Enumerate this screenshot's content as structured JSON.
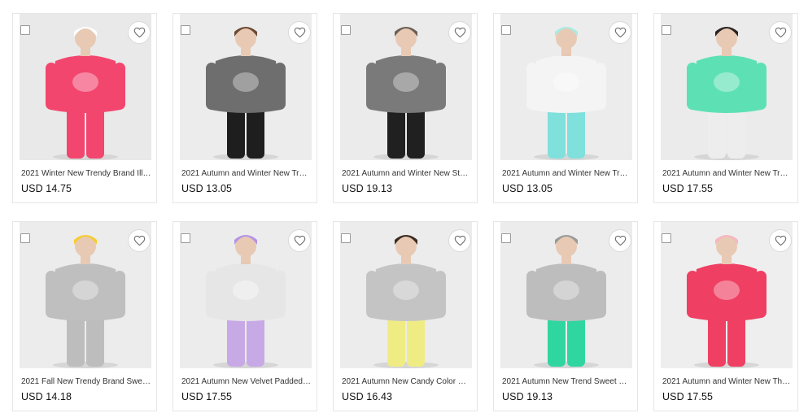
{
  "products": [
    {
      "title": "2021 Winter New Trendy Brand Illu…",
      "price": "USD 14.75",
      "palette": {
        "bg": "#e9e9e9",
        "top": "#f2466f",
        "bottom": "#f2466f",
        "hat": "#ffffff",
        "skin": "#e8c9b3"
      }
    },
    {
      "title": "2021 Autumn and Winter New Tren…",
      "price": "USD 13.05",
      "palette": {
        "bg": "#ececec",
        "top": "#6e6e6e",
        "bottom": "#1e1e1e",
        "hat": "#6b4a34",
        "skin": "#e8c9b3"
      }
    },
    {
      "title": "2021 Autumn and Winter New Styl…",
      "price": "USD 19.13",
      "palette": {
        "bg": "#ebebeb",
        "top": "#7a7a7a",
        "bottom": "#202020",
        "hat": "#6a6057",
        "skin": "#e8c9b3"
      }
    },
    {
      "title": "2021 Autumn and Winter New Tren…",
      "price": "USD 13.05",
      "palette": {
        "bg": "#ececec",
        "top": "#f4f4f4",
        "bottom": "#7fe0dc",
        "hat": "#a9ece3",
        "skin": "#e8c9b3"
      }
    },
    {
      "title": "2021 Autumn and Winter New Tren…",
      "price": "USD 17.55",
      "palette": {
        "bg": "#ebebeb",
        "top": "#5ee0b5",
        "bottom": "#ededed",
        "hat": "#2a2320",
        "skin": "#e8c9b3"
      }
    },
    {
      "title": "2021 Fall New Trendy Brand Sweet …",
      "price": "USD 14.18",
      "palette": {
        "bg": "#ececec",
        "top": "#bfbfbf",
        "bottom": "#bdbdbd",
        "hat": "#f6cc2f",
        "skin": "#e8c9b3"
      }
    },
    {
      "title": "2021 Autumn New Velvet Padded L…",
      "price": "USD 17.55",
      "palette": {
        "bg": "#ececec",
        "top": "#e6e6e6",
        "bottom": "#c7a9e6",
        "hat": "#b393e6",
        "skin": "#e8c9b3"
      }
    },
    {
      "title": "2021 Autumn New Candy Color Gir…",
      "price": "USD 16.43",
      "palette": {
        "bg": "#ececec",
        "top": "#c4c4c4",
        "bottom": "#f0ec84",
        "hat": "#3a2a20",
        "skin": "#e8c9b3"
      }
    },
    {
      "title": "2021 Autumn New Trend Sweet Co…",
      "price": "USD 19.13",
      "palette": {
        "bg": "#ececec",
        "top": "#bdbdbd",
        "bottom": "#2fd6a0",
        "hat": "#9a9a9a",
        "skin": "#e8c9b3"
      }
    },
    {
      "title": "2021 Autumn and Winter New Thr…",
      "price": "USD 17.55",
      "palette": {
        "bg": "#eeeeee",
        "top": "#ef3f63",
        "bottom": "#ef3f63",
        "hat": "#f7b6c2",
        "skin": "#e8c9b3"
      }
    }
  ],
  "icons": {
    "favorite": "heart-outline-icon",
    "select": "checkbox"
  }
}
